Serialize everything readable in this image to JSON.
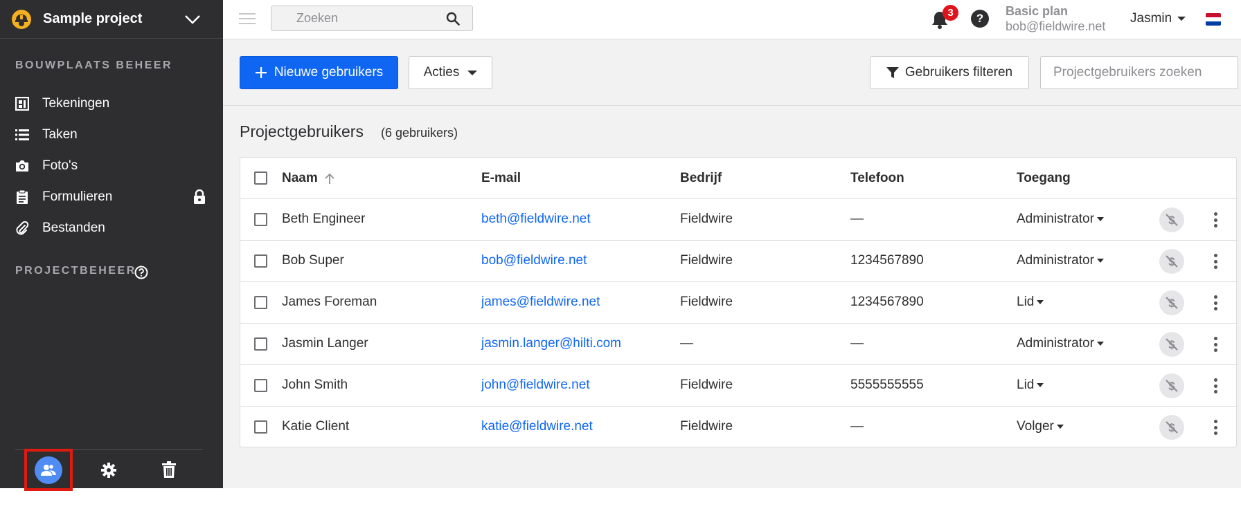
{
  "sidebar": {
    "project_name": "Sample project",
    "section1_title": "BOUWPLAATS BEHEER",
    "items": [
      {
        "label": "Tekeningen",
        "icon": "plans-icon"
      },
      {
        "label": "Taken",
        "icon": "list-icon"
      },
      {
        "label": "Foto's",
        "icon": "camera-icon"
      },
      {
        "label": "Formulieren",
        "icon": "clipboard-icon",
        "locked": true
      },
      {
        "label": "Bestanden",
        "icon": "paperclip-icon"
      }
    ],
    "section2_title": "PROJECTBEHEER",
    "bottom_icons": [
      "users-icon",
      "gear-icon",
      "trash-icon"
    ]
  },
  "topbar": {
    "search_placeholder": "Zoeken",
    "notification_count": "3",
    "help_label": "?",
    "plan_name": "Basic plan",
    "plan_email": "bob@fieldwire.net",
    "user_name": "Jasmin"
  },
  "toolbar": {
    "new_users_label": "Nieuwe gebruikers",
    "actions_label": "Acties",
    "filter_label": "Gebruikers filteren",
    "search_placeholder": "Projectgebruikers zoeken"
  },
  "content": {
    "title": "Projectgebruikers",
    "count": "(6 gebruikers)"
  },
  "table": {
    "headers": {
      "name": "Naam",
      "email": "E-mail",
      "company": "Bedrijf",
      "phone": "Telefoon",
      "access": "Toegang"
    },
    "rows": [
      {
        "name": "Beth Engineer",
        "email": "beth@fieldwire.net",
        "company": "Fieldwire",
        "phone": "—",
        "access": "Administrator"
      },
      {
        "name": "Bob Super",
        "email": "bob@fieldwire.net",
        "company": "Fieldwire",
        "phone": "1234567890",
        "access": "Administrator"
      },
      {
        "name": "James Foreman",
        "email": "james@fieldwire.net",
        "company": "Fieldwire",
        "phone": "1234567890",
        "access": "Lid"
      },
      {
        "name": "Jasmin Langer",
        "email": "jasmin.langer@hilti.com",
        "company": "—",
        "phone": "—",
        "access": "Administrator"
      },
      {
        "name": "John Smith",
        "email": "john@fieldwire.net",
        "company": "Fieldwire",
        "phone": "5555555555",
        "access": "Lid"
      },
      {
        "name": "Katie Client",
        "email": "katie@fieldwire.net",
        "company": "Fieldwire",
        "phone": "—",
        "access": "Volger"
      }
    ]
  },
  "colors": {
    "sidebar_bg": "#2e2e30",
    "primary": "#0f66f2",
    "badge": "#e0151b",
    "highlight": "#e11a0f",
    "users_avatar": "#4f8df5"
  }
}
